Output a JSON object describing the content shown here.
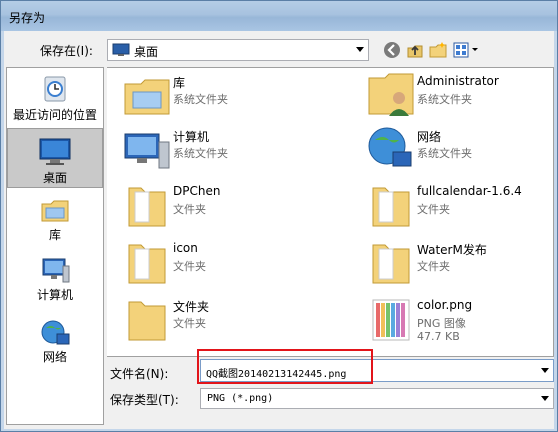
{
  "window": {
    "title": "另存为"
  },
  "toolbar": {
    "save_in_label": "保存在(I):",
    "save_in_value": "桌面",
    "back_icon": "back-icon",
    "up_icon": "up-folder-icon",
    "new_folder_icon": "new-folder-icon",
    "view_icon": "view-menu-icon"
  },
  "places": [
    {
      "label": "最近访问的位置",
      "icon": "recent-places-icon",
      "selected": false
    },
    {
      "label": "桌面",
      "icon": "desktop-icon",
      "selected": true
    },
    {
      "label": "库",
      "icon": "libraries-icon",
      "selected": false
    },
    {
      "label": "计算机",
      "icon": "computer-icon",
      "selected": false
    },
    {
      "label": "网络",
      "icon": "network-icon",
      "selected": false
    }
  ],
  "files": [
    {
      "name": "库",
      "sub": "系统文件夹",
      "icon": "library-folder-icon"
    },
    {
      "name": "Administrator",
      "sub": "系统文件夹",
      "icon": "user-folder-icon"
    },
    {
      "name": "计算机",
      "sub": "系统文件夹",
      "icon": "computer-icon"
    },
    {
      "name": "网络",
      "sub": "系统文件夹",
      "icon": "network-icon"
    },
    {
      "name": "DPChen",
      "sub": "文件夹",
      "icon": "folder-icon"
    },
    {
      "name": "fullcalendar-1.6.4",
      "sub": "文件夹",
      "icon": "folder-icon"
    },
    {
      "name": "icon",
      "sub": "文件夹",
      "icon": "folder-icon"
    },
    {
      "name": "WaterM发布",
      "sub": "文件夹",
      "icon": "folder-icon"
    },
    {
      "name": "文件夹",
      "sub": "文件夹",
      "icon": "folder-icon"
    },
    {
      "name": "color.png",
      "sub": "PNG 图像",
      "sub2": "47.7 KB",
      "icon": "png-image-icon"
    }
  ],
  "form": {
    "filename_label": "文件名(N):",
    "filename_value": "QQ截图20140213142445.png",
    "filetype_label": "保存类型(T):",
    "filetype_value": "PNG (*.png)"
  },
  "colors": {
    "highlight_box": "#e2141a",
    "title_bar": "#a7c2df",
    "folder": "#f3d27a"
  }
}
